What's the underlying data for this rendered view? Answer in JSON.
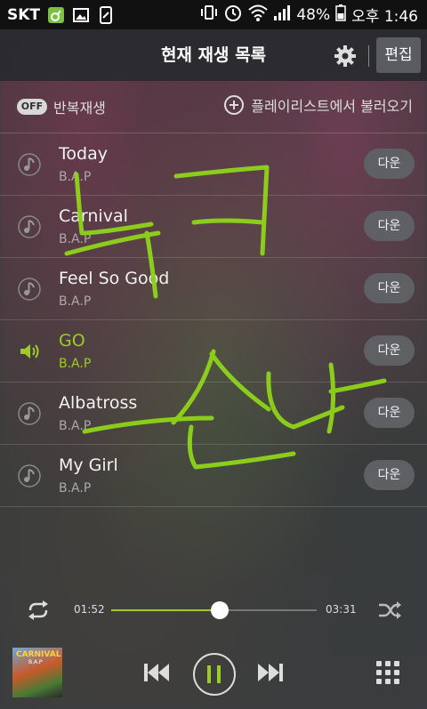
{
  "status": {
    "carrier": "SKT",
    "battery": "48%",
    "time": "오후 1:46"
  },
  "header": {
    "title": "현재 재생 목록",
    "edit_label": "편집"
  },
  "options": {
    "repeat_badge": "OFF",
    "repeat_label": "반복재생",
    "load_playlist_label": "플레이리스트에서 불러오기"
  },
  "tracks": [
    {
      "title": "Today",
      "artist": "B.A.P",
      "download_label": "다운",
      "playing": false
    },
    {
      "title": "Carnival",
      "artist": "B.A.P",
      "download_label": "다운",
      "playing": false
    },
    {
      "title": "Feel So Good",
      "artist": "B.A.P",
      "download_label": "다운",
      "playing": false
    },
    {
      "title": "GO",
      "artist": "B.A.P",
      "download_label": "다운",
      "playing": true
    },
    {
      "title": "Albatross",
      "artist": "B.A.P",
      "download_label": "다운",
      "playing": false
    },
    {
      "title": "My Girl",
      "artist": "B.A.P",
      "download_label": "다운",
      "playing": false
    }
  ],
  "player": {
    "current_time": "01:52",
    "total_time": "03:31",
    "progress": 0.53,
    "album_title": "CARNIVAL",
    "album_artist": "B.A.P"
  },
  "colors": {
    "accent": "#9ccc27",
    "scribble": "#8fd41a"
  }
}
